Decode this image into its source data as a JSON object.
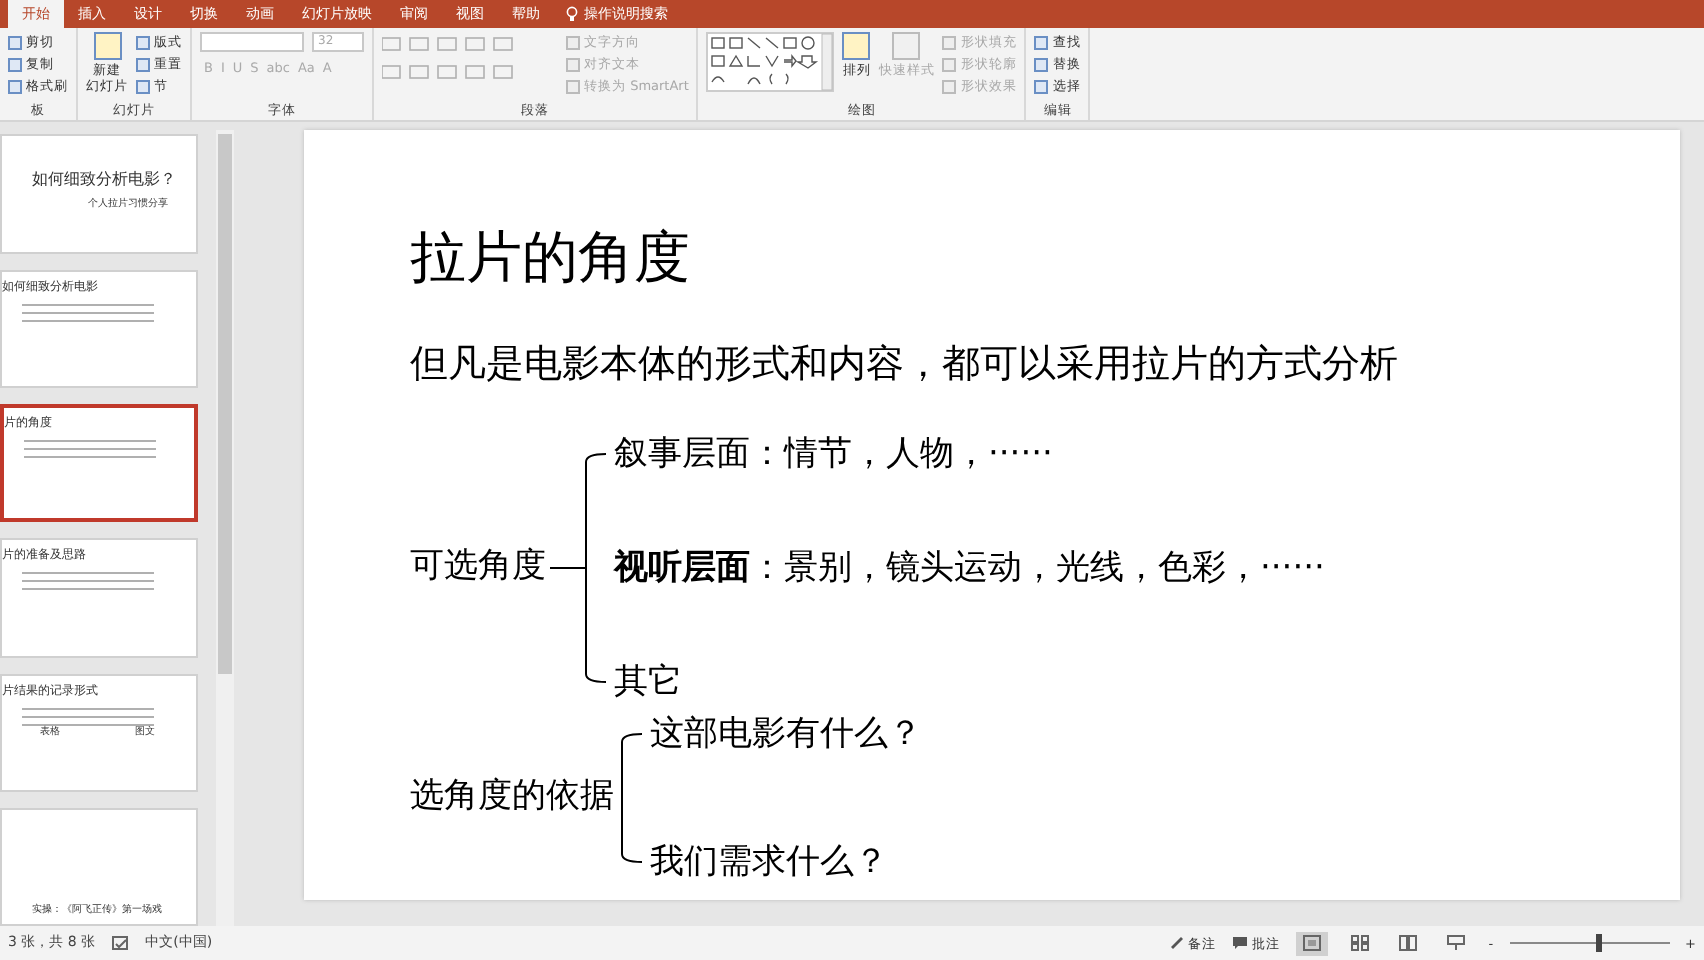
{
  "tabs": [
    {
      "label": "开始",
      "selected": true
    },
    {
      "label": "插入",
      "selected": false
    },
    {
      "label": "设计",
      "selected": false
    },
    {
      "label": "切换",
      "selected": false
    },
    {
      "label": "动画",
      "selected": false
    },
    {
      "label": "幻灯片放映",
      "selected": false
    },
    {
      "label": "审阅",
      "selected": false
    },
    {
      "label": "视图",
      "selected": false
    },
    {
      "label": "帮助",
      "selected": false
    }
  ],
  "tell_me": {
    "placeholder": "操作说明搜索"
  },
  "ribbon_groups": [
    {
      "label": "板",
      "controls": [
        {
          "kind": "stack",
          "items": [
            {
              "label": "剪切",
              "disabled": false
            },
            {
              "label": "复制",
              "disabled": false
            },
            {
              "label": "格式刷",
              "disabled": false
            }
          ]
        }
      ]
    },
    {
      "label": "幻灯片",
      "controls": [
        {
          "kind": "large",
          "lines": [
            "新建",
            "幻灯片"
          ],
          "disabled": false
        },
        {
          "kind": "stack",
          "items": [
            {
              "label": "版式",
              "disabled": false
            },
            {
              "label": "重置",
              "disabled": false
            },
            {
              "label": "节",
              "disabled": false
            }
          ]
        }
      ]
    },
    {
      "label": "字体",
      "controls": [
        {
          "kind": "font",
          "size": "32",
          "buttons": [
            "B",
            "I",
            "U",
            "S",
            "abc",
            "Aa",
            "A"
          ],
          "disabled": true
        }
      ]
    },
    {
      "label": "段落",
      "controls": [
        {
          "kind": "paragraph",
          "disabled": true
        },
        {
          "kind": "stack",
          "items": [
            {
              "label": "文字方向",
              "disabled": true
            },
            {
              "label": "对齐文本",
              "disabled": true
            },
            {
              "label": "转换为 SmartArt",
              "disabled": true
            }
          ]
        }
      ]
    },
    {
      "label": "绘图",
      "controls": [
        {
          "kind": "shapes"
        },
        {
          "kind": "large",
          "lines": [
            "排列"
          ],
          "disabled": false
        },
        {
          "kind": "large",
          "lines": [
            "快速样式"
          ],
          "disabled": true
        },
        {
          "kind": "stack",
          "items": [
            {
              "label": "形状填充",
              "disabled": true
            },
            {
              "label": "形状轮廓",
              "disabled": true
            },
            {
              "label": "形状效果",
              "disabled": true
            }
          ]
        }
      ]
    },
    {
      "label": "编辑",
      "controls": [
        {
          "kind": "stack",
          "items": [
            {
              "label": "查找",
              "disabled": false
            },
            {
              "label": "替换",
              "disabled": false
            },
            {
              "label": "选择",
              "disabled": false
            }
          ]
        }
      ]
    }
  ],
  "thumbnails": [
    {
      "kind": "title",
      "title": "如何细致分析电影？",
      "subtitle": "个人拉片习惯分享",
      "selected": false
    },
    {
      "kind": "content",
      "title": "如何细致分析电影",
      "selected": false
    },
    {
      "kind": "content",
      "title": "片的角度",
      "selected": true
    },
    {
      "kind": "content",
      "title": "片的准备及思路",
      "selected": false
    },
    {
      "kind": "content",
      "title": "片结果的记录形式",
      "labels": [
        "表格",
        "图文"
      ],
      "selected": false
    },
    {
      "kind": "footer",
      "title": "实操：《阿飞正传》第一场戏",
      "selected": false
    }
  ],
  "slide": {
    "title": "拉片的角度",
    "intro": "但凡是电影本体的形式和内容，都可以采用拉片的方式分析",
    "trees": [
      {
        "label": "可选角度",
        "branches": [
          "叙事层面：情节，人物，······",
          "**视听层面**：景别，镜头运动，光线，色彩，······",
          "其它"
        ]
      },
      {
        "label": "选角度的依据",
        "branches": [
          "这部电影有什么？",
          "我们需求什么？"
        ]
      }
    ]
  },
  "status_bar": {
    "slide_count": "3 张，共 8 张",
    "language": "中文(中国)",
    "notes": "备注",
    "comments": "批注",
    "views": [
      {
        "kind": "normal",
        "selected": true
      },
      {
        "kind": "sorter",
        "selected": false
      },
      {
        "kind": "reading",
        "selected": false
      },
      {
        "kind": "show",
        "selected": false
      }
    ],
    "zoom_out": "-",
    "zoom_in": "+",
    "zoom": {
      "level": 0.55
    }
  }
}
